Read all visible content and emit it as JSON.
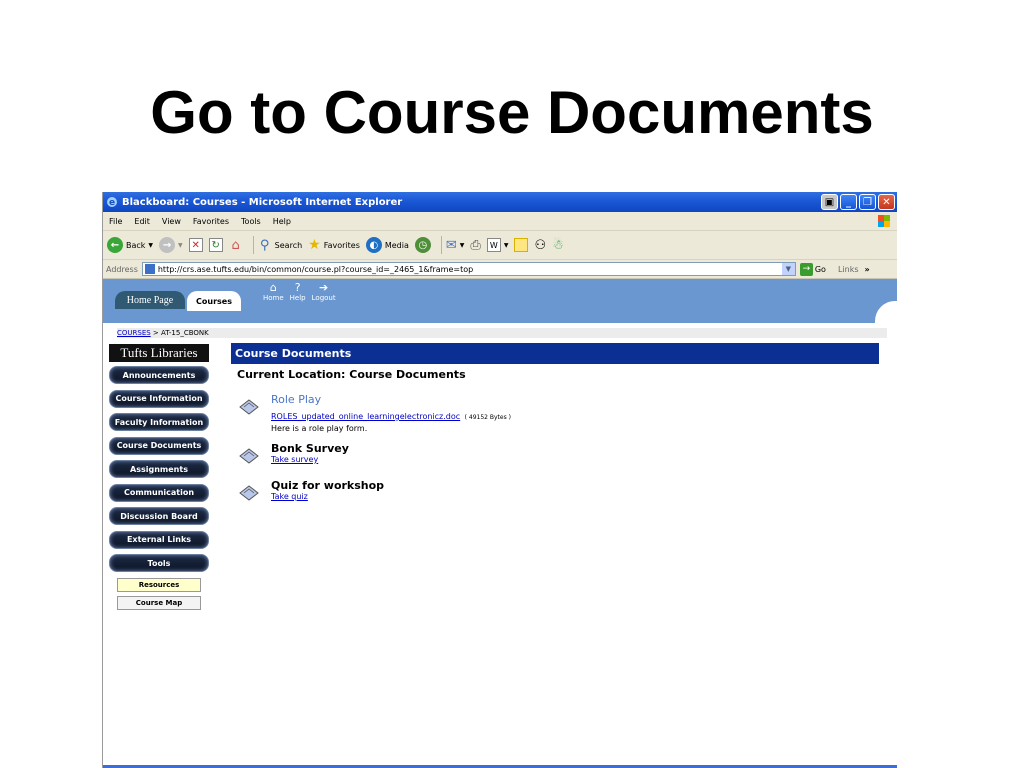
{
  "slide": {
    "title": "Go to Course Documents"
  },
  "window": {
    "title": "Blackboard: Courses - Microsoft Internet Explorer"
  },
  "menu": [
    "File",
    "Edit",
    "View",
    "Favorites",
    "Tools",
    "Help"
  ],
  "toolbar": {
    "back": "Back",
    "search": "Search",
    "favorites": "Favorites",
    "media": "Media"
  },
  "address": {
    "label": "Address",
    "url": "http://crs.ase.tufts.edu/bin/common/course.pl?course_id=_2465_1&frame=top",
    "go": "Go",
    "links": "Links"
  },
  "bb_header": {
    "home_tab": "Home Page",
    "courses_tab": "Courses",
    "icons": [
      "Home",
      "Help",
      "Logout"
    ]
  },
  "breadcrumb": {
    "link": "COURSES",
    "rest": " > AT-15_CBONK"
  },
  "sidebar": {
    "library": "Tufts Libraries",
    "nav": [
      "Announcements",
      "Course Information",
      "Faculty Information",
      "Course Documents",
      "Assignments",
      "Communication",
      "Discussion Board",
      "External Links",
      "Tools"
    ],
    "sub": [
      "Resources",
      "Course Map"
    ]
  },
  "content": {
    "header": "Course Documents",
    "location": "Current Location: Course Documents",
    "items": [
      {
        "title": "Role Play",
        "link": "ROLES_updated_online_learningelectronicz.doc",
        "size": "( 49152 Bytes )",
        "desc": "Here is a role play form."
      },
      {
        "title": "Bonk Survey",
        "link": "Take survey"
      },
      {
        "title": "Quiz for workshop",
        "link": "Take quiz"
      }
    ]
  }
}
